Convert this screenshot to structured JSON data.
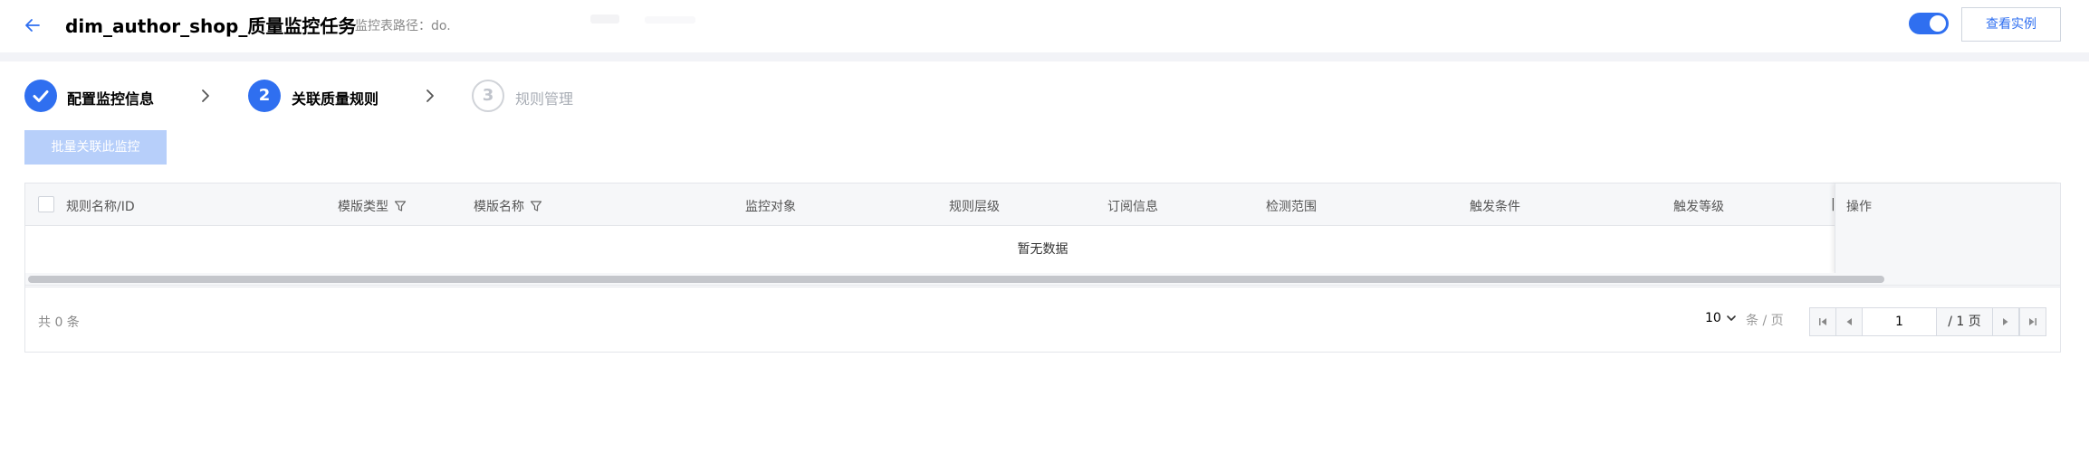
{
  "header": {
    "title": "dim_author_shop_质量监控任务",
    "path_label": "监控表路径：do.",
    "view_button": "查看实例",
    "toggle_on": true
  },
  "steps": [
    {
      "number": "1",
      "label": "配置监控信息",
      "state": "done"
    },
    {
      "number": "2",
      "label": "关联质量规则",
      "state": "active"
    },
    {
      "number": "3",
      "label": "规则管理",
      "state": "todo"
    }
  ],
  "toolbar": {
    "batch_button": "批量关联此监控"
  },
  "table": {
    "columns": [
      {
        "label": "规则名称/ID",
        "filter": false
      },
      {
        "label": "模版类型",
        "filter": true
      },
      {
        "label": "模版名称",
        "filter": true
      },
      {
        "label": "监控对象",
        "filter": false
      },
      {
        "label": "规则层级",
        "filter": false
      },
      {
        "label": "订阅信息",
        "filter": false
      },
      {
        "label": "检测范围",
        "filter": false
      },
      {
        "label": "触发条件",
        "filter": false
      },
      {
        "label": "触发等级",
        "filter": false
      },
      {
        "label": "操作",
        "filter": false
      }
    ],
    "empty_text": "暂无数据"
  },
  "pagination": {
    "total_label": "共 0 条",
    "page_size": "10",
    "per_page_label": "条 / 页",
    "current_page": "1",
    "total_pages_label": "/ 1 页"
  },
  "colors": {
    "accent": "#2f6ff0",
    "disabled_button": "#b7cffa"
  }
}
